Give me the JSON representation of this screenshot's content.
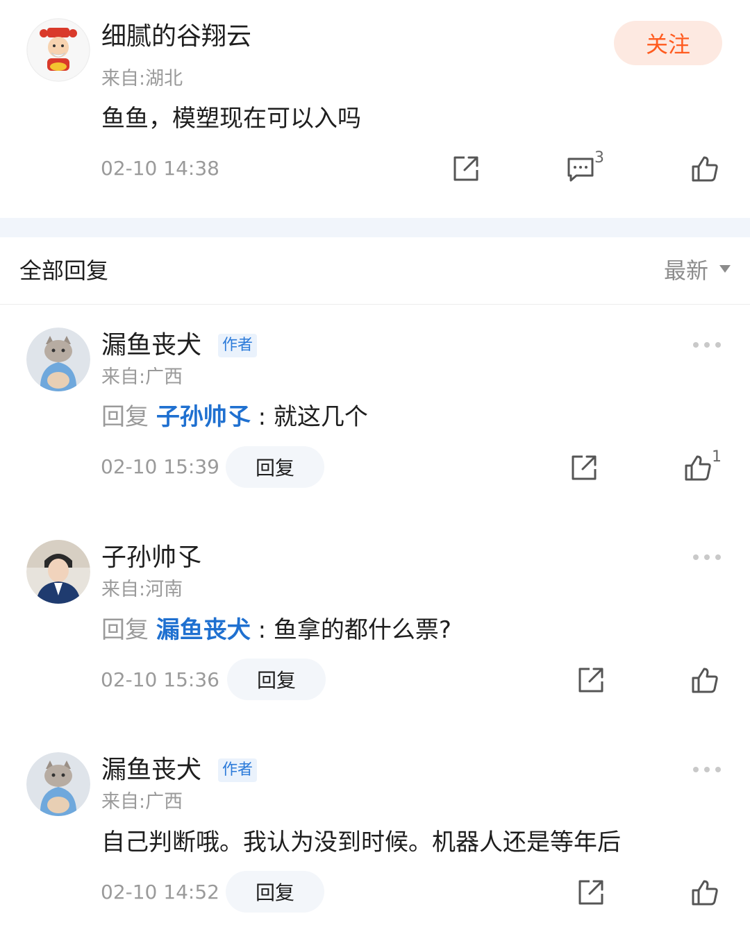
{
  "post": {
    "author": "细腻的谷翔云",
    "location": "来自:湖北",
    "content": "鱼鱼，模塑现在可以入吗",
    "time": "02-10 14:38",
    "follow_label": "关注",
    "comment_count": "3",
    "icons": {
      "share": "share-icon",
      "comment": "comment-icon",
      "like": "thumbs-up-icon"
    },
    "colors": {
      "follow_bg": "#fde9e1",
      "follow_text": "#ff5b1f"
    }
  },
  "replies_header": {
    "title": "全部回复",
    "sort_label": "最新"
  },
  "replies": [
    {
      "author": "漏鱼丧犬",
      "badge": "作者",
      "location": "来自:广西",
      "reply_prefix": "回复",
      "mention": "子孙帅孓",
      "separator": ":",
      "content": "就这几个",
      "time": "02-10 15:39",
      "reply_label": "回复",
      "like_count": "1"
    },
    {
      "author": "子孙帅孓",
      "location": "来自:河南",
      "reply_prefix": "回复",
      "mention": "漏鱼丧犬",
      "separator": ":",
      "content": "鱼拿的都什么票?",
      "time": "02-10 15:36",
      "reply_label": "回复"
    },
    {
      "author": "漏鱼丧犬",
      "badge": "作者",
      "location": "来自:广西",
      "content": "自己判断哦。我认为没到时候。机器人还是等年后",
      "time": "02-10 14:52",
      "reply_label": "回复"
    }
  ],
  "colors": {
    "mention": "#1f70d0",
    "badge_bg": "#eaf2fc",
    "badge_text": "#2b7ad9",
    "muted_text": "#9a9a9a",
    "band": "#f1f5fb"
  }
}
